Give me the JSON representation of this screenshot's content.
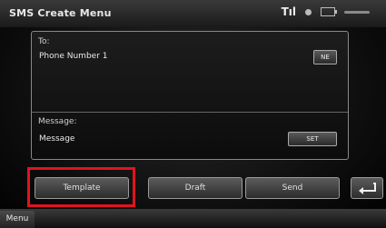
{
  "header": {
    "title": "SMS Create Menu",
    "signal_label": "Tıl"
  },
  "form": {
    "to_label": "To:",
    "to_value": "Phone Number 1",
    "to_button": "NE",
    "message_label": "Message:",
    "message_value": "Message",
    "message_button": "SET"
  },
  "buttons": {
    "template": "Template",
    "draft": "Draft",
    "send": "Send"
  },
  "footer": {
    "menu": "Menu"
  },
  "colors": {
    "highlight": "#e0141e"
  }
}
